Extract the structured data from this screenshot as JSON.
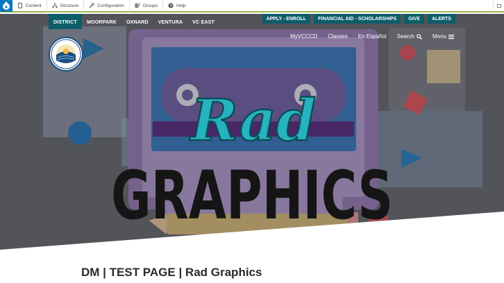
{
  "admin_toolbar": {
    "items": [
      {
        "label": "Content",
        "icon": "document-icon"
      },
      {
        "label": "Structure",
        "icon": "sitemap-icon"
      },
      {
        "label": "Configuration",
        "icon": "wrench-icon"
      },
      {
        "label": "Groups",
        "icon": "group-icon"
      },
      {
        "label": "Help",
        "icon": "question-icon"
      }
    ]
  },
  "district_tabs": [
    "DISTRICT",
    "MOORPARK",
    "OXNARD",
    "VENTURA",
    "VC EAST"
  ],
  "utility_buttons": [
    "APPLY - ENROLL",
    "FINANCIAL AID - SCHOLARSHIPS",
    "GIVE",
    "ALERTS"
  ],
  "secondary_nav": {
    "myvcccd": "MyVCCCD",
    "classes": "Classes",
    "espanol": "En Español",
    "search": "Search",
    "menu": "Menu"
  },
  "hero": {
    "title_script": "Rad",
    "title_block": "GRAPHICS"
  },
  "page": {
    "title": "DM | TEST PAGE | Rad Graphics"
  },
  "colors": {
    "accent": "#0d5d69",
    "admin_bar_border": "#9bb54a",
    "drupal_blue": "#0678be",
    "title_text": "#2b2b2b"
  }
}
